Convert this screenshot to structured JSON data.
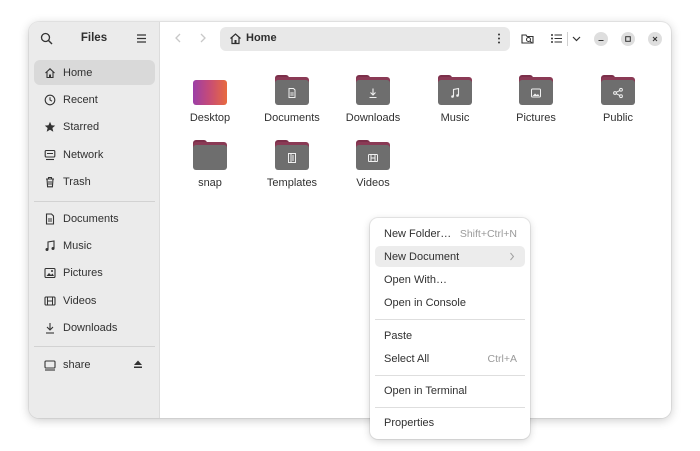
{
  "window": {
    "app_title": "Files"
  },
  "sidebar": {
    "places": [
      {
        "label": "Home",
        "icon": "home-icon",
        "active": true
      },
      {
        "label": "Recent",
        "icon": "clock-icon",
        "active": false
      },
      {
        "label": "Starred",
        "icon": "star-icon",
        "active": false
      },
      {
        "label": "Network",
        "icon": "network-icon",
        "active": false
      },
      {
        "label": "Trash",
        "icon": "trash-icon",
        "active": false
      }
    ],
    "bookmarks": [
      {
        "label": "Documents",
        "icon": "document-icon"
      },
      {
        "label": "Music",
        "icon": "music-note-icon"
      },
      {
        "label": "Pictures",
        "icon": "picture-icon"
      },
      {
        "label": "Videos",
        "icon": "film-icon"
      },
      {
        "label": "Downloads",
        "icon": "download-icon"
      }
    ],
    "devices": [
      {
        "label": "share",
        "icon": "drive-icon"
      }
    ]
  },
  "toolbar": {
    "path_label": "Home"
  },
  "files": [
    {
      "label": "Desktop",
      "emblem": "none"
    },
    {
      "label": "Documents",
      "emblem": "document-icon"
    },
    {
      "label": "Downloads",
      "emblem": "download-icon"
    },
    {
      "label": "Music",
      "emblem": "music-note-icon"
    },
    {
      "label": "Pictures",
      "emblem": "picture-icon"
    },
    {
      "label": "Public",
      "emblem": "share-icon"
    },
    {
      "label": "snap",
      "emblem": "none"
    },
    {
      "label": "Templates",
      "emblem": "template-icon"
    },
    {
      "label": "Videos",
      "emblem": "film-icon"
    }
  ],
  "context_menu": {
    "new_folder": "New Folder…",
    "new_folder_accel": "Shift+Ctrl+N",
    "new_document": "New Document",
    "open_with": "Open With…",
    "open_console": "Open in Console",
    "paste": "Paste",
    "select_all": "Select All",
    "select_all_accel": "Ctrl+A",
    "open_terminal": "Open in Terminal",
    "properties": "Properties"
  },
  "colors": {
    "folder_accent": "#8a3a55",
    "folder_body": "#6e6e6e",
    "sidebar_bg": "#ebebeb",
    "active_item_bg": "#d9d9d9"
  }
}
